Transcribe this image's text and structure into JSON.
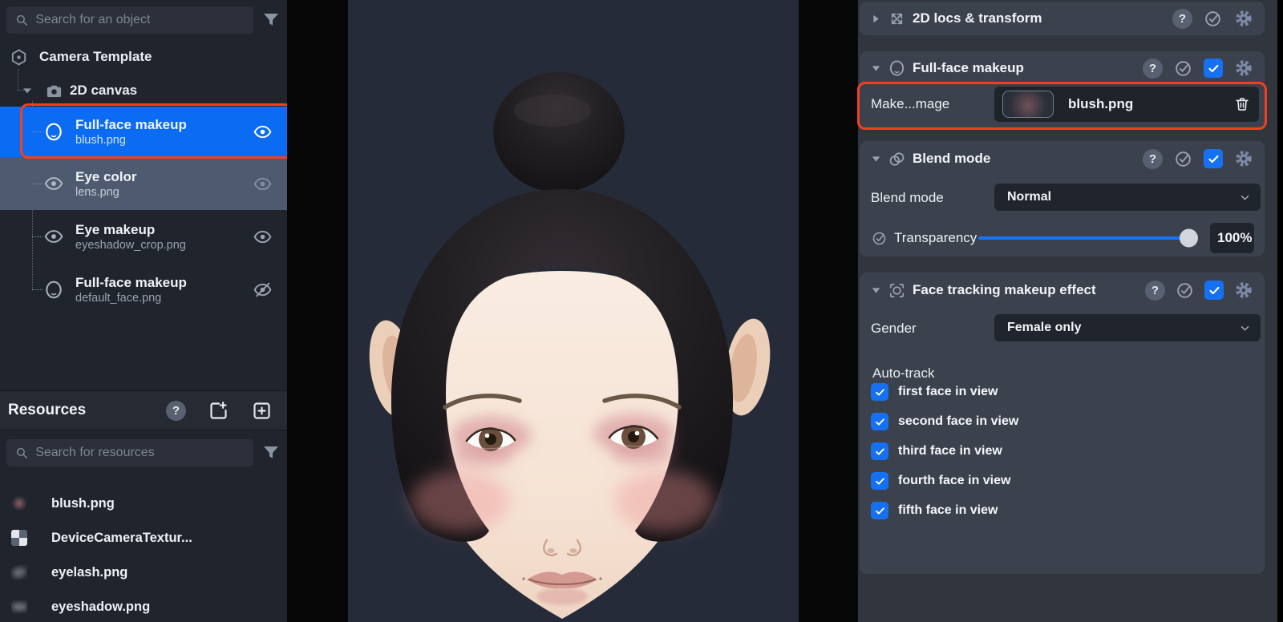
{
  "icons": {
    "help_glyph": "?"
  },
  "left_panel": {
    "object_search": {
      "placeholder": "Search for an object"
    },
    "root_item": {
      "label": "Camera Template"
    },
    "canvas_item": {
      "label": "2D canvas"
    },
    "layers": [
      {
        "title": "Full-face makeup",
        "subtitle": "blush.png",
        "visible": true,
        "selected": true,
        "highlighted": true
      },
      {
        "title": "Eye color",
        "subtitle": "lens.png",
        "visible": true,
        "selected": false
      },
      {
        "title": "Eye makeup",
        "subtitle": "eyeshadow_crop.png",
        "visible": true,
        "selected": false
      },
      {
        "title": "Full-face makeup",
        "subtitle": "default_face.png",
        "visible": false,
        "selected": false
      }
    ],
    "resources": {
      "title": "Resources",
      "search": {
        "placeholder": "Search for resources"
      },
      "items": [
        {
          "label": "blush.png"
        },
        {
          "label": "DeviceCameraTextur..."
        },
        {
          "label": "eyelash.png"
        },
        {
          "label": "eyeshadow.png"
        }
      ]
    }
  },
  "inspector": {
    "locs_section": {
      "title": "2D locs & transform",
      "collapsed": true
    },
    "makeup_section": {
      "title": "Full-face makeup",
      "enabled": true,
      "image_label": "Make...mage",
      "image_value": "blush.png",
      "highlighted": true
    },
    "blend_section": {
      "title": "Blend mode",
      "enabled": true,
      "mode_label": "Blend mode",
      "mode_value": "Normal",
      "transparency_label": "Transparency",
      "transparency_value": "100%",
      "transparency_percent": 100
    },
    "tracking_section": {
      "title": "Face tracking makeup effect",
      "enabled": true,
      "gender_label": "Gender",
      "gender_value": "Female only",
      "auto_track_label": "Auto-track",
      "checkboxes": [
        {
          "label": "first face in view",
          "checked": true
        },
        {
          "label": "second face in view",
          "checked": true
        },
        {
          "label": "third face in view",
          "checked": true
        },
        {
          "label": "fourth face in view",
          "checked": true
        },
        {
          "label": "fifth face in view",
          "checked": true
        }
      ]
    }
  },
  "appearance": {
    "accent_blue": "#0b6cf3",
    "checkbox_blue": "#1671f2",
    "slider_blue": "#1573ff",
    "highlight_red": "#f53e1d",
    "left_panel_bg": "#1f242d",
    "right_panel_bg": "#30353e",
    "card_bg": "#3c424d",
    "preview_bg": "#252b38"
  }
}
